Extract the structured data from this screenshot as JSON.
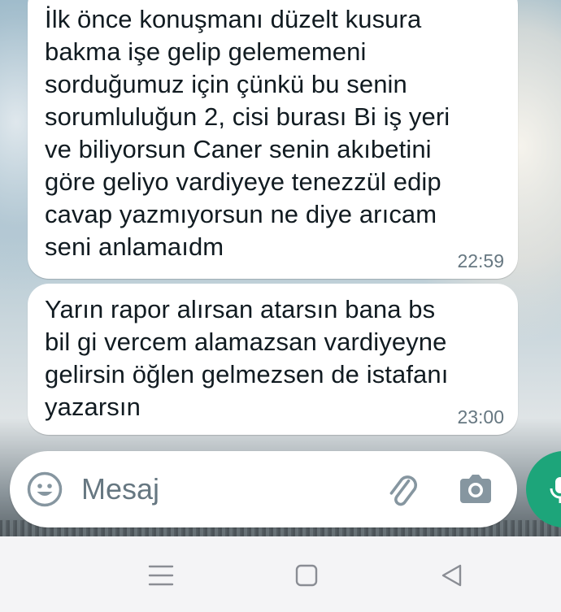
{
  "messages": [
    {
      "text": "İlk önce konuşmanı düzelt kusura\nbakma işe gelip gelememeni\nsorduğumuz için çünkü bu senin\nsorumluluğun 2, cisi burası Bi iş yeri\nve biliyorsun Caner senin akıbetini\ngöre geliyo vardiyeye tenezzül edip\ncavap yazmıyorsun ne diye arıcam\nseni anlamaıdm",
      "time": "22:59"
    },
    {
      "text": "Yarın rapor alırsan atarsın bana bs\nbil gi vercem alamazsan vardiyeyne\ngelirsin öğlen gelmezsen de istafanı\nyazarsın",
      "time": "23:00"
    }
  ],
  "composer": {
    "placeholder": "Mesaj",
    "value": ""
  },
  "icons": {
    "emoji": "emoji-icon",
    "attach": "paperclip-icon",
    "camera": "camera-icon",
    "send": "microphone-icon",
    "nav_menu": "recent-apps-icon",
    "nav_home": "home-icon",
    "nav_back": "back-icon"
  },
  "colors": {
    "bubble": "#ffffff",
    "text": "#111b21",
    "timestamp": "#667781",
    "send_button": "#1da57a",
    "navbar": "#f4f4f6"
  }
}
